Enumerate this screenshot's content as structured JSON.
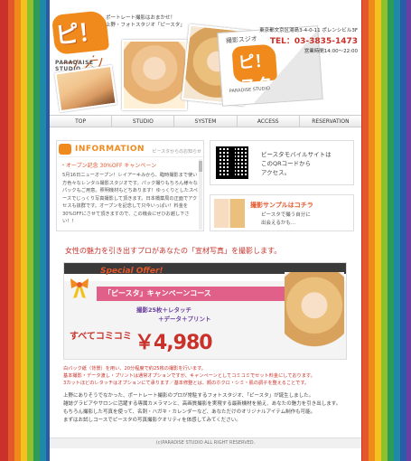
{
  "header": {
    "logo_text": "ピ！スタ",
    "logo_sub": "PARADAISE STUDIO",
    "tagline_line1": "ポートレート撮影はおまかせ！",
    "tagline_line2": "上野・フォトスタジオ「ピースタ」",
    "sign_title": "撮影スジオ",
    "sign_logo": "ピ！スタ",
    "sign_sub": "PARADISE STUDIO",
    "address": "東京都文京区湯島3-4-0-11 ポレンシビル3F",
    "tel": "TEL：03-3835-1473",
    "hours": "営業時間14:00〜22:00"
  },
  "nav": {
    "items": [
      {
        "label": "TOP"
      },
      {
        "label": "STUDIO"
      },
      {
        "label": "SYSTEM"
      },
      {
        "label": "ACCESS"
      },
      {
        "label": "RESERVATION"
      }
    ]
  },
  "info": {
    "title": "INFORMATION",
    "subtitle": "ピースタからのお知らせ",
    "news_title": "・オープン記念 30%OFF キャンペーン",
    "news_body": "5月16日ニューオープン！レイアーキみから、臨時撮影まで使い方色々なレンタル撮影スタジオです。パック撮りもちろん様々なパックもご用意。照明機材もどちあります！ゆっくりとしたスペースでじっくり写真撮影して頂きます。日本橋薬局の正面でアクセスも抜群です。オープンを記念して只今いっぱい！料金を30%OFFにさせて頂きますので、この機会にぜひお越し下さい！！"
  },
  "qr": {
    "text_line1": "ピースタモバイルサイトは",
    "text_line2": "このQRコードから",
    "text_line3": "アクセス。"
  },
  "sample": {
    "title": "撮影サンプルはコチラ",
    "text_line1": "ピースタで撮う自分に",
    "text_line2": "出会えるかも…"
  },
  "main": {
    "lead": "女性の魅力を引き出すプロがあなたの「宣材写真」を撮影します。"
  },
  "offer": {
    "head": "Special Offer!",
    "course": "「ピースタ」キャンペーンコース",
    "line1": "撮影25枚＋レタッチ",
    "line2": "＋データ＋プリント",
    "all_in": "すべてコミコミ",
    "price": "￥4,980"
  },
  "notes": {
    "line1": "白バック紙（背景）を用い、20分程度で約25枚の撮影を行います。",
    "line2": "基本撮影・データ渡し・プリントは通常オプションですが、キャンペーンとしてコミコミでセット料金にしております。",
    "line3": "3カットほどのレタッチはオプションにて承ります／基本修整とは、顔のホクロ・シミ・肌の調子を整えることです。"
  },
  "desc": {
    "line1": "上野にありそうでなかった、ポートレート撮影のプロが常駐するフォトスタジオ、「ピースタ」が誕生しました。",
    "line2": "雑誌グラビアやサロンに活躍する専属カメラマンと、高画質撮影を実現する最新機材を揃え、あなたの魅力を引き出します。",
    "line3": "もちろん撮影した写真を使って、名刺・ハガキ・カレンダーなど、あなただけのオリジナルアイテム制作も可能。",
    "line4": "まずはお試しコースでピースタの写真撮影クオリティを体感してみてください。"
  },
  "footer": {
    "text": "(c)PARADISE STUDIO ALL RIGHT RESERVED."
  }
}
